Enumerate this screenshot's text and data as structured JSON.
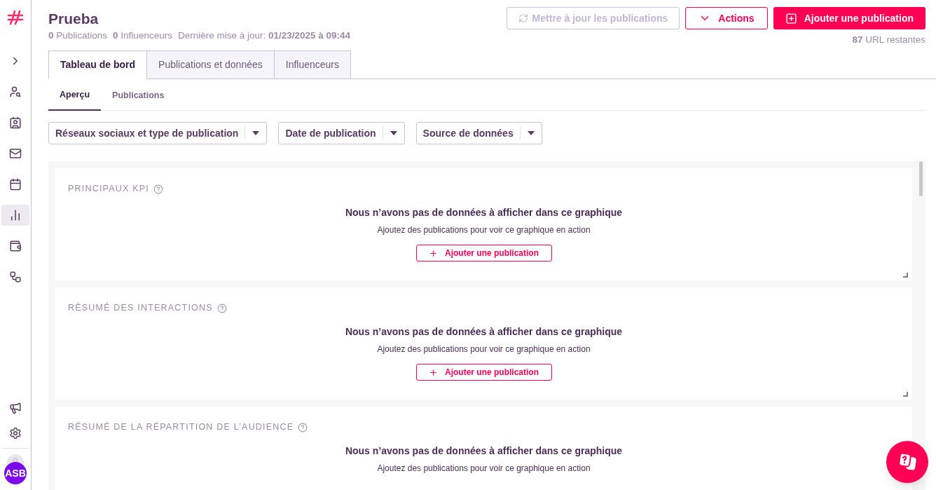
{
  "sidebar": {
    "items": [
      {
        "selected": false
      },
      {
        "selected": false
      },
      {
        "selected": false
      },
      {
        "selected": false
      },
      {
        "selected": false
      },
      {
        "selected": true
      },
      {
        "selected": false
      },
      {
        "selected": false
      }
    ],
    "user_initials": "ASB"
  },
  "header": {
    "title": "Prueba",
    "stats": [
      {
        "count": "0",
        "label": "Publications"
      },
      {
        "count": "0",
        "label": "Influenceurs"
      }
    ],
    "updated_label": "Dernière mise à jour:",
    "updated_value": "01/23/2025 à 09:44"
  },
  "actions": {
    "refresh": {
      "label": "Mettre à jour les publications",
      "disabled": true
    },
    "menu": "Actions",
    "add": "Ajouter une publication",
    "remaining_count": "87",
    "remaining_label": "URL restantes"
  },
  "tabs": [
    {
      "label": "Tableau de bord",
      "selected": true
    },
    {
      "label": "Publications et données",
      "selected": false
    },
    {
      "label": "Influenceurs",
      "selected": false
    }
  ],
  "subtabs": [
    {
      "label": "Aperçu",
      "selected": true
    },
    {
      "label": "Publications",
      "selected": false
    }
  ],
  "filters": [
    "Réseaux sociaux et type de publication",
    "Date de publication",
    "Source de données"
  ],
  "cards": [
    {
      "title": "PRINCIPAUX KPI",
      "empty_title": "Nous n’avons pas de données à afficher dans ce graphique",
      "empty_text": "Ajoutez des publications pour voir ce graphique en action",
      "button": "Ajouter une publication",
      "resizable": true
    },
    {
      "title": "RÉSUMÉ DES INTERACTIONS",
      "empty_title": "Nous n’avons pas de données à afficher dans ce graphique",
      "empty_text": "Ajoutez des publications pour voir ce graphique en action",
      "button": "Ajouter une publication",
      "resizable": true
    },
    {
      "title": "RÉSUMÉ DE LA RÉPARTITION DE L’AUDIENCE",
      "empty_title": "Nous n’avons pas de données à afficher dans ce graphique",
      "empty_text": "Ajoutez des publications pour voir ce graphique en action"
    }
  ]
}
